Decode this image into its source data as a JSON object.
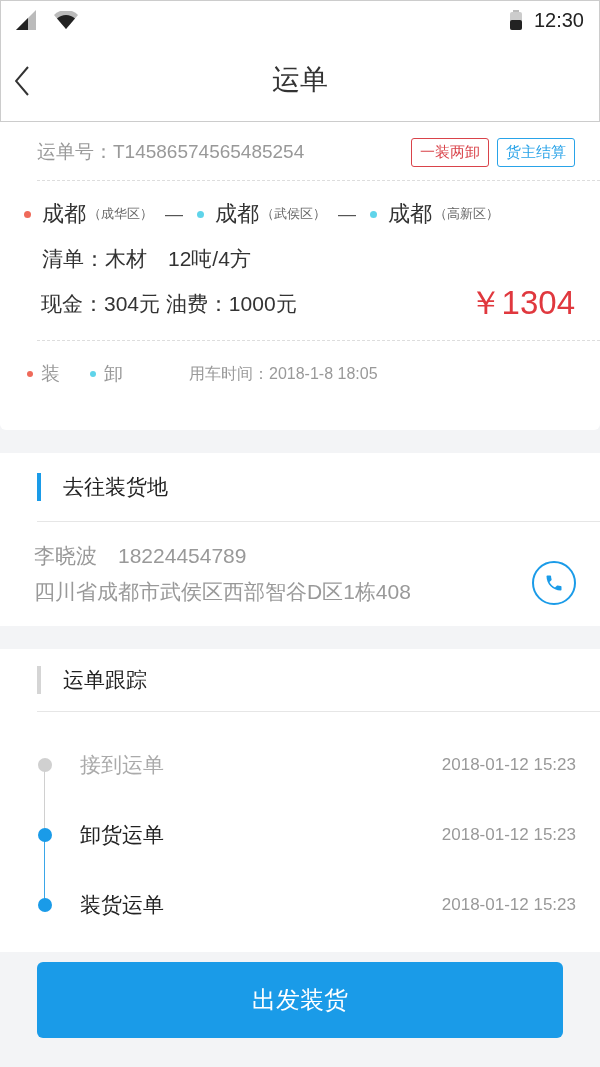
{
  "status_bar": {
    "time": "12:30"
  },
  "nav": {
    "title": "运单"
  },
  "order": {
    "number": "运单号：T14586574565485254",
    "tags": [
      {
        "label": "一装两卸",
        "color": "#d9434a"
      },
      {
        "label": "货主结算",
        "color": "#29a3e8"
      }
    ],
    "route": [
      {
        "city": "成都",
        "district": "（成华区）",
        "color": "#ef6a5a"
      },
      {
        "city": "成都",
        "district": "（武侯区）",
        "color": "#5fd4ea"
      },
      {
        "city": "成都",
        "district": "（高新区）",
        "color": "#5fd4ea"
      }
    ],
    "route_separator": "—",
    "cargo": "清单：木材　12吨/4方",
    "payment": "现金：304元  油费：1000元",
    "total": "￥1304",
    "legend": [
      {
        "label": "装",
        "color": "#ef6a5a"
      },
      {
        "label": "卸",
        "color": "#5fd4ea"
      }
    ],
    "use_time": "用车时间：2018-1-8  18:05"
  },
  "destination": {
    "heading": "去往装货地",
    "contact": "李晓波　18224454789",
    "address": "四川省成都市武侯区西部智谷D区1栋408"
  },
  "tracking": {
    "heading": "运单跟踪",
    "steps": [
      {
        "label": "接到运单",
        "time": "2018-01-12  15:23",
        "active": false
      },
      {
        "label": "卸货运单",
        "time": "2018-01-12  15:23",
        "active": true
      },
      {
        "label": "装货运单",
        "time": "2018-01-12  15:23",
        "active": true
      }
    ]
  },
  "action_button": "出发装货"
}
